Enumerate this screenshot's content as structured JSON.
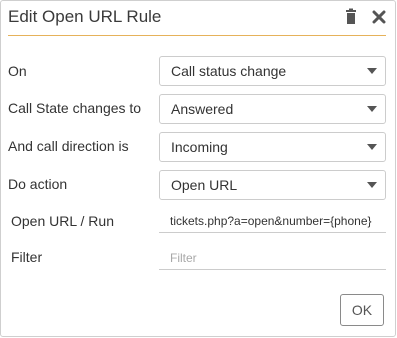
{
  "dialog": {
    "title": "Edit Open URL Rule",
    "header_icons": [
      "trash-icon",
      "close-icon"
    ]
  },
  "fields": {
    "on": {
      "label": "On",
      "value": "Call status change"
    },
    "call_state": {
      "label": "Call State changes to",
      "value": "Answered"
    },
    "direction": {
      "label": "And call direction is",
      "value": "Incoming"
    },
    "action": {
      "label": "Do action",
      "value": "Open URL"
    },
    "open_url": {
      "label": "Open URL / Run",
      "value": "tickets.php?a=open&number={phone}"
    },
    "filter": {
      "label": "Filter",
      "value": "",
      "placeholder": "Filter"
    }
  },
  "buttons": {
    "ok_label": "OK"
  },
  "colors": {
    "header_divider": "#e6b25a",
    "icon": "#555555",
    "border": "#cccccc"
  }
}
